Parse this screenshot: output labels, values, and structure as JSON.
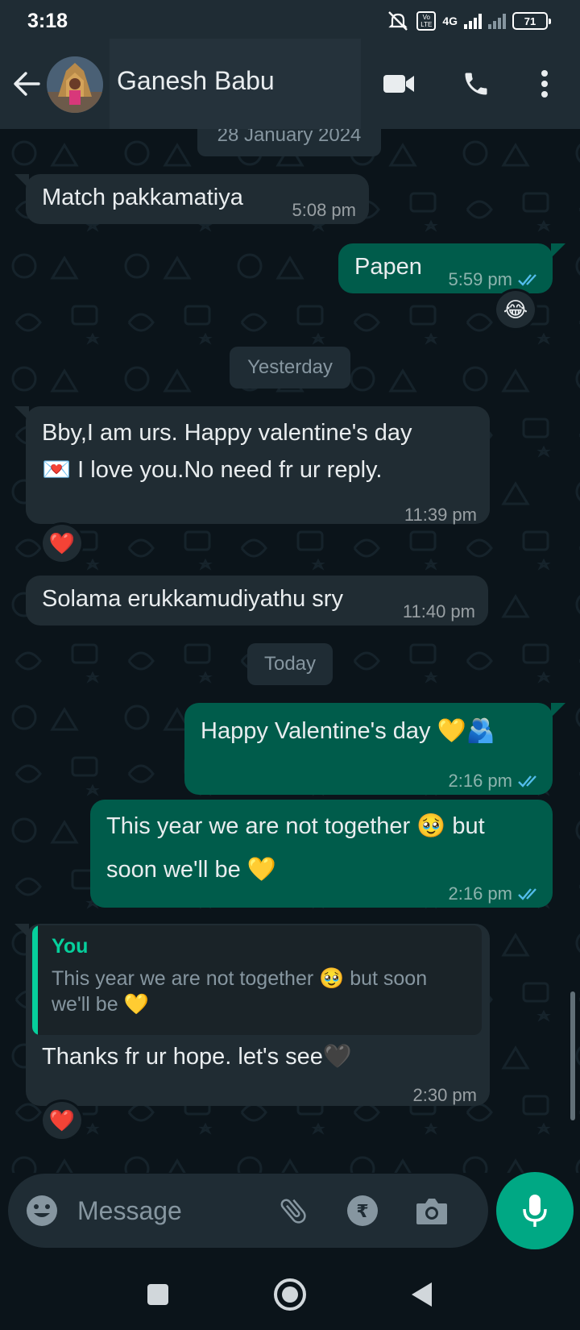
{
  "status_bar": {
    "time": "3:18",
    "network_label": "4G",
    "volte_label": "Vo LTE",
    "battery": "71"
  },
  "header": {
    "contact_name": "Ganesh Babu",
    "icons": [
      "back-arrow-icon",
      "video-call-icon",
      "phone-icon",
      "more-vert-icon"
    ]
  },
  "colors": {
    "incoming_bubble": "#202c33",
    "outgoing_bubble": "#005c4b",
    "accent": "#00a884",
    "read_ticks": "#53bdeb"
  },
  "chat": {
    "dates": [
      "28 January 2024",
      "Yesterday",
      "Today"
    ],
    "messages": [
      {
        "direction": "in",
        "text": "Match pakkamatiya",
        "time": "5:08 pm"
      },
      {
        "direction": "out",
        "text": "Papen",
        "time": "5:59 pm",
        "status": "read",
        "reaction": "😂"
      },
      {
        "direction": "in",
        "line1": "Bby,I am urs. Happy valentine's day",
        "line2": "💌 I love you.No need fr ur reply.",
        "time": "11:39 pm",
        "reaction": "❤️"
      },
      {
        "direction": "in",
        "text": "Solama erukkamudiyathu sry",
        "time": "11:40 pm"
      },
      {
        "direction": "out",
        "text": "Happy Valentine's day 💛🫂",
        "time": "2:16 pm",
        "status": "read"
      },
      {
        "direction": "out",
        "line1": "This year we are not together 🥹 but",
        "line2": "soon we'll be 💛",
        "time": "2:16 pm",
        "status": "read"
      },
      {
        "direction": "in",
        "quote_author": "You",
        "quote_text": "This year we are not together 🥹 but soon we'll be 💛",
        "text": "Thanks fr ur hope. let's see🖤",
        "time": "2:30 pm",
        "reaction": "❤️"
      }
    ]
  },
  "input": {
    "placeholder": "Message",
    "icons": [
      "emoji-icon",
      "attach-icon",
      "rupee-payment-icon",
      "camera-icon",
      "mic-icon"
    ]
  },
  "nav": {
    "icons": [
      "recents-square-icon",
      "home-circle-icon",
      "back-triangle-icon"
    ]
  }
}
